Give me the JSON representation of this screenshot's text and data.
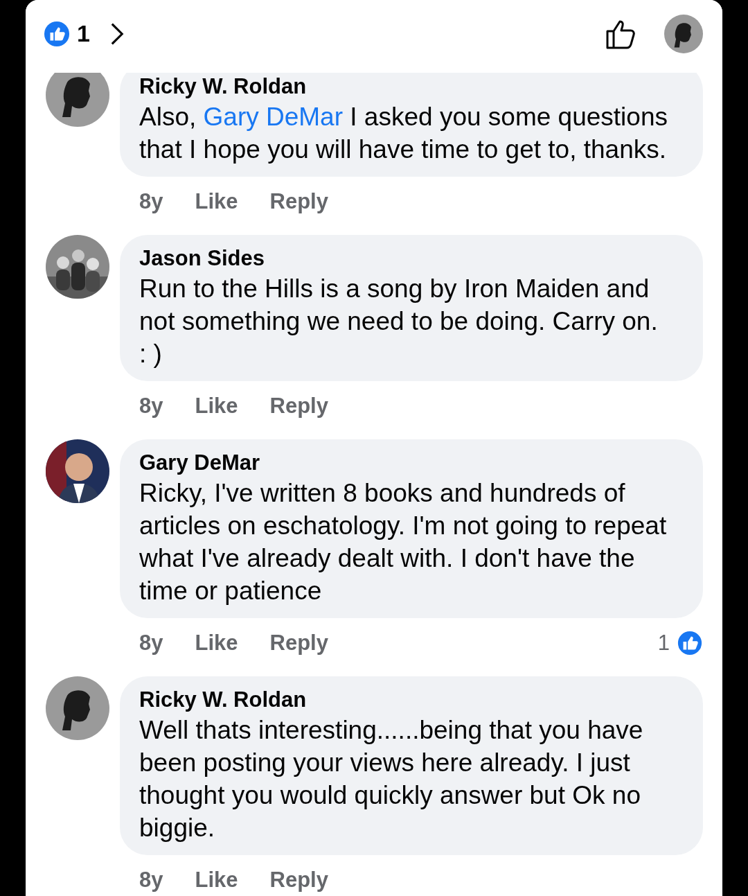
{
  "header": {
    "reaction_count": "1"
  },
  "comments": [
    {
      "author": "Ricky W. Roldan",
      "text": [
        {
          "kind": "plain",
          "text": "Also, "
        },
        {
          "kind": "mention",
          "text": "Gary DeMar"
        },
        {
          "kind": "plain",
          "text": " I asked you some questions that I hope you will have time to get to, thanks."
        }
      ],
      "time": "8y",
      "actions": [
        "Like",
        "Reply"
      ]
    },
    {
      "author": "Jason Sides",
      "avatar": {
        "kind": "picture"
      },
      "text": [
        {
          "kind": "plain",
          "text": "Run to the Hills is a song by Iron Maiden and not something we need to be doing. Carry on. : )"
        }
      ],
      "time": "8y",
      "actions": [
        "Like",
        "Reply"
      ]
    },
    {
      "author": "Gary DeMar",
      "avatar": {
        "kind": "picture"
      },
      "text": [
        {
          "kind": "plain",
          "text": "Ricky, I've written 8 books and hundreds of articles on eschatology. I'm not going to repeat what I've already dealt with. I don't have the time or patience"
        }
      ],
      "time": "8y",
      "actions": [
        "Like",
        "Reply"
      ],
      "reaction_count": "1"
    },
    {
      "author": "Ricky W. Roldan",
      "text": [
        {
          "kind": "plain",
          "text": "Well thats interesting......being that you have been posting your views here already. I just thought you would quickly answer but Ok no biggie."
        }
      ],
      "time": "8y",
      "actions": [
        "Like",
        "Reply"
      ]
    }
  ]
}
